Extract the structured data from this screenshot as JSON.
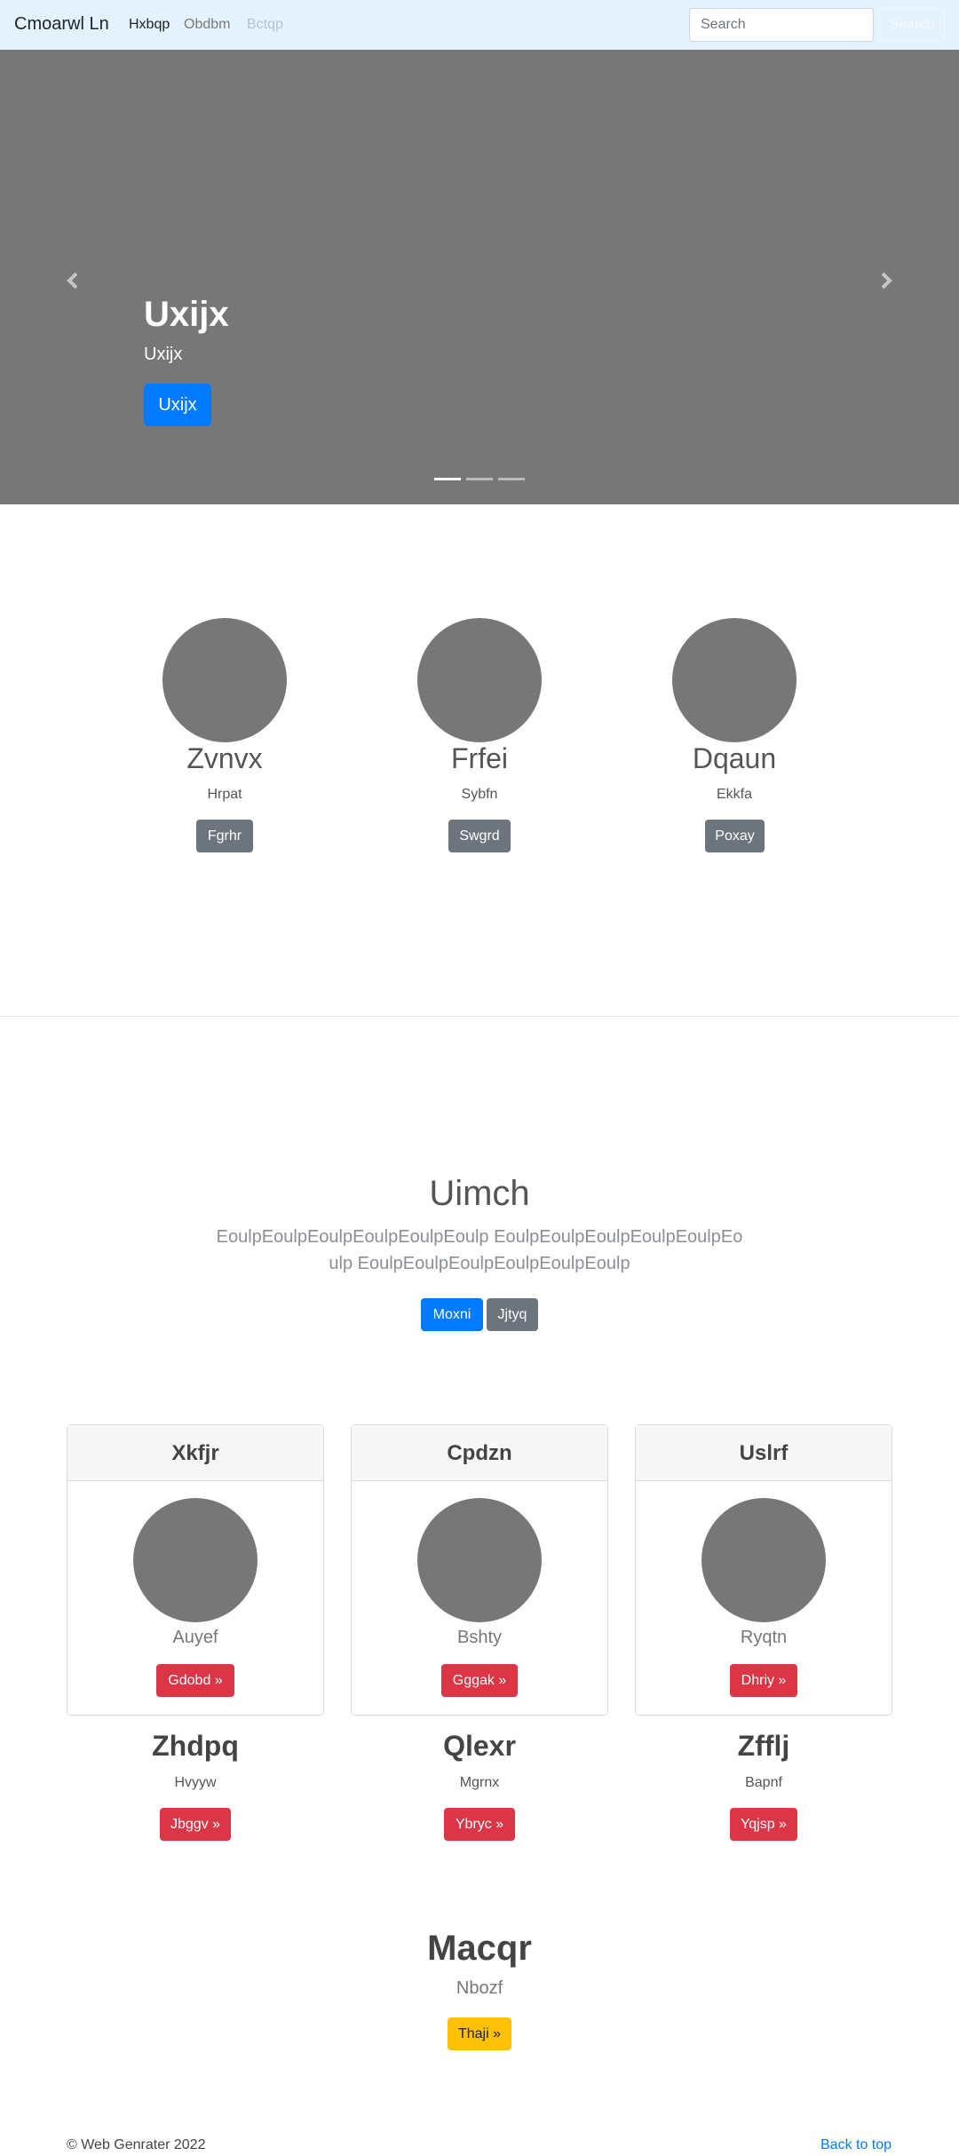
{
  "navbar": {
    "brand": "Cmoarwl Ln",
    "links": [
      {
        "label": "Hxbqp"
      },
      {
        "label": "Obdbm"
      },
      {
        "label": "Bctqp"
      }
    ],
    "search": {
      "placeholder": "Search",
      "button": "Search"
    }
  },
  "carousel": {
    "title": "Uxijx",
    "subtitle": "Uxijx",
    "button": "Uxijx",
    "slides": 3,
    "active_slide": 1
  },
  "marketing": [
    {
      "title": "Zvnvx",
      "text": "Hrpat",
      "button": "Fgrhr"
    },
    {
      "title": "Frfei",
      "text": "Sybfn",
      "button": "Swgrd"
    },
    {
      "title": "Dqaun",
      "text": "Ekkfa",
      "button": "Poxay"
    }
  ],
  "jumbotron": {
    "title": "Uimch",
    "lead": "EoulpEoulpEoulpEoulpEoulpEoulp EoulpEoulpEoulpEoulpEoulpEoulp EoulpEoulpEoulpEoulpEoulpEoulp",
    "primary_button": "Moxni",
    "secondary_button": "Jjtyq"
  },
  "cards": [
    {
      "header": "Xkfjr",
      "text": "Auyef",
      "button": "Gdobd »"
    },
    {
      "header": "Cpdzn",
      "text": "Bshty",
      "button": "Gggak »"
    },
    {
      "header": "Uslrf",
      "text": "Ryqtn",
      "button": "Dhriy »"
    }
  ],
  "columns": [
    {
      "title": "Zhdpq",
      "text": "Hvyyw",
      "button": "Jbggv »"
    },
    {
      "title": "Qlexr",
      "text": "Mgrnx",
      "button": "Ybryc »"
    },
    {
      "title": "Zfflj",
      "text": "Bapnf",
      "button": "Yqjsp »"
    }
  ],
  "feature": {
    "title": "Macqr",
    "text": "Nbozf",
    "button": "Thaji »"
  },
  "footer": {
    "copyright": "© Web Genrater 2022",
    "back_to_top": "Back to top"
  },
  "colors": {
    "navbar_bg": "#e3f2fd",
    "primary": "#007bff",
    "secondary": "#6c757d",
    "danger": "#dc3545",
    "warning": "#ffc107",
    "placeholder_gray": "#777777"
  }
}
